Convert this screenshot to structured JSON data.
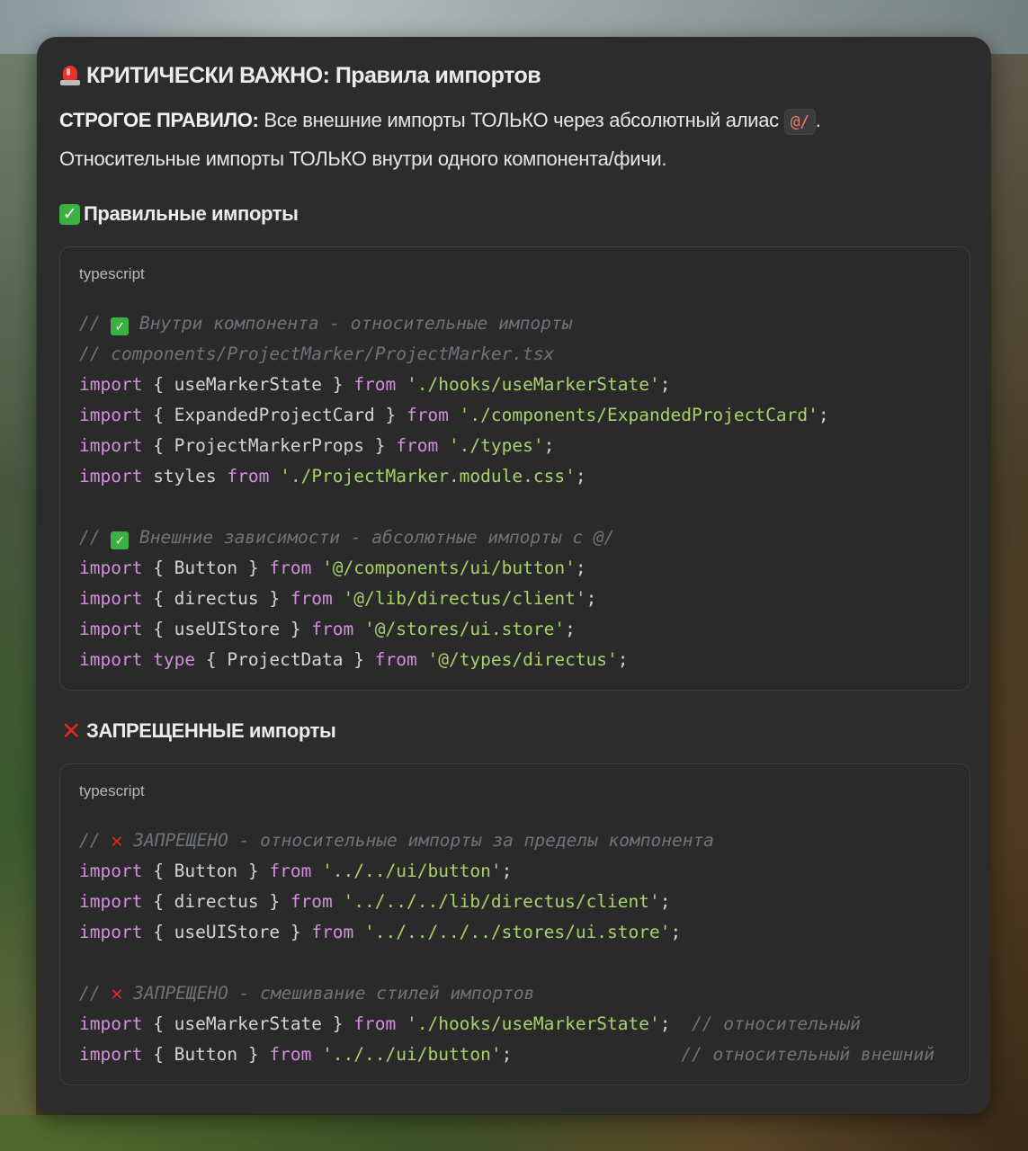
{
  "title": {
    "emoji": "siren",
    "text": "КРИТИЧЕСКИ ВАЖНО: Правила импортов"
  },
  "intro": {
    "strong": "СТРОГОЕ ПРАВИЛО:",
    "text1": " Все внешние импорты ТОЛЬКО через абсолютный алиас ",
    "alias": "@/",
    "text2": ".",
    "line2": "Относительные импорты ТОЛЬКО внутри одного компонента/фичи."
  },
  "section_correct": {
    "heading": "Правильные импорты",
    "lang": "typescript",
    "lines": [
      {
        "c1": "// ",
        "icon": "check",
        "c2": " Внутри компонента - относительные импорты"
      },
      {
        "comment": "// components/ProjectMarker/ProjectMarker.tsx"
      },
      {
        "k1": "import",
        "p1": " { useMarkerState } ",
        "k2": "from",
        "p2": " ",
        "s": "'./hooks/useMarkerState'",
        "p3": ";"
      },
      {
        "k1": "import",
        "p1": " { ExpandedProjectCard } ",
        "k2": "from",
        "p2": " ",
        "s": "'./components/ExpandedProjectCard'",
        "p3": ";"
      },
      {
        "k1": "import",
        "p1": " { ProjectMarkerProps } ",
        "k2": "from",
        "p2": " ",
        "s": "'./types'",
        "p3": ";"
      },
      {
        "k1": "import",
        "p1": " styles ",
        "k2": "from",
        "p2": " ",
        "s": "'./ProjectMarker.module.css'",
        "p3": ";"
      },
      {
        "blank": ""
      },
      {
        "c1": "// ",
        "icon": "check",
        "c2": " Внешние зависимости - абсолютные импорты с @/"
      },
      {
        "k1": "import",
        "p1": " { Button } ",
        "k2": "from",
        "p2": " ",
        "s": "'@/components/ui/button'",
        "p3": ";"
      },
      {
        "k1": "import",
        "p1": " { directus } ",
        "k2": "from",
        "p2": " ",
        "s": "'@/lib/directus/client'",
        "p3": ";"
      },
      {
        "k1": "import",
        "p1": " { useUIStore } ",
        "k2": "from",
        "p2": " ",
        "s": "'@/stores/ui.store'",
        "p3": ";"
      },
      {
        "k1": "import",
        "k1b": " type",
        "p1": " { ProjectData } ",
        "k2": "from",
        "p2": " ",
        "s": "'@/types/directus'",
        "p3": ";"
      }
    ]
  },
  "section_forbidden": {
    "heading": "ЗАПРЕЩЕННЫЕ импорты",
    "lang": "typescript",
    "lines": [
      {
        "c1": "// ",
        "icon": "cross",
        "c2": " ЗАПРЕЩЕНО - относительные импорты за пределы компонента"
      },
      {
        "k1": "import",
        "p1": " { Button } ",
        "k2": "from",
        "p2": " ",
        "s": "'../../ui/button'",
        "p3": ";"
      },
      {
        "k1": "import",
        "p1": " { directus } ",
        "k2": "from",
        "p2": " ",
        "s": "'../../../lib/directus/client'",
        "p3": ";"
      },
      {
        "k1": "import",
        "p1": " { useUIStore } ",
        "k2": "from",
        "p2": " ",
        "s": "'../../../../stores/ui.store'",
        "p3": ";"
      },
      {
        "blank": ""
      },
      {
        "c1": "// ",
        "icon": "cross",
        "c2": " ЗАПРЕЩЕНО - смешивание стилей импортов"
      },
      {
        "k1": "import",
        "p1": " { useMarkerState } ",
        "k2": "from",
        "p2": " ",
        "s": "'./hooks/useMarkerState'",
        "p3": ";  ",
        "tail": "// относительный"
      },
      {
        "k1": "import",
        "p1": " { Button } ",
        "k2": "from",
        "p2": " ",
        "s": "'../../ui/button'",
        "p3": ";                ",
        "tail": "// относительный внешний"
      }
    ]
  },
  "colors": {
    "keyword": "#d58ee0",
    "string": "#a8d26a",
    "comment": "#6f737a",
    "panel": "#2c2c2c"
  }
}
